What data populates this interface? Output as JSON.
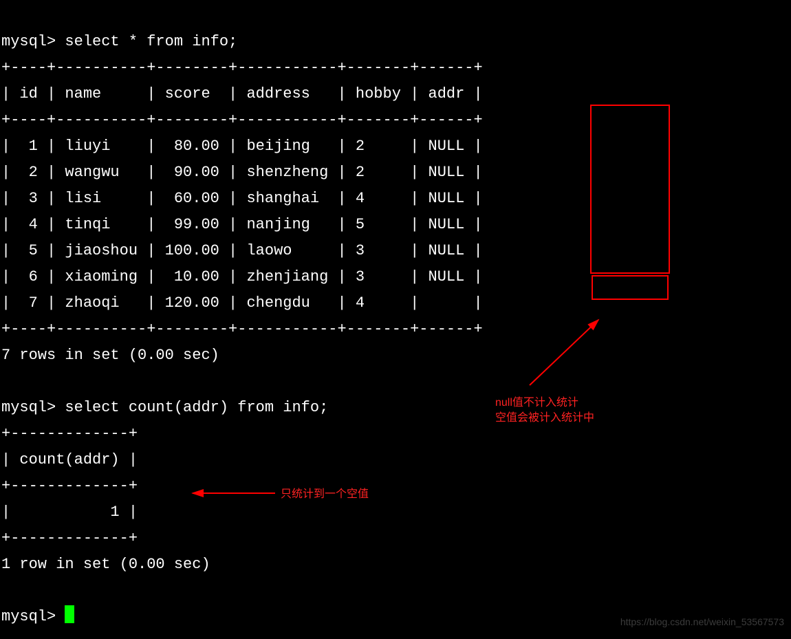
{
  "chart_data": {
    "type": "table",
    "query": "select * from info;",
    "columns": [
      "id",
      "name",
      "score",
      "address",
      "hobby",
      "addr"
    ],
    "rows": [
      {
        "id": 1,
        "name": "liuyi",
        "score": "80.00",
        "address": "beijing",
        "hobby": 2,
        "addr": "NULL"
      },
      {
        "id": 2,
        "name": "wangwu",
        "score": "90.00",
        "address": "shenzheng",
        "hobby": 2,
        "addr": "NULL"
      },
      {
        "id": 3,
        "name": "lisi",
        "score": "60.00",
        "address": "shanghai",
        "hobby": 4,
        "addr": "NULL"
      },
      {
        "id": 4,
        "name": "tinqi",
        "score": "99.00",
        "address": "nanjing",
        "hobby": 5,
        "addr": "NULL"
      },
      {
        "id": 5,
        "name": "jiaoshou",
        "score": "100.00",
        "address": "laowo",
        "hobby": 3,
        "addr": "NULL"
      },
      {
        "id": 6,
        "name": "xiaoming",
        "score": "10.00",
        "address": "zhenjiang",
        "hobby": 3,
        "addr": "NULL"
      },
      {
        "id": 7,
        "name": "zhaoqi",
        "score": "120.00",
        "address": "chengdu",
        "hobby": 4,
        "addr": ""
      }
    ],
    "footer": "7 rows in set (0.00 sec)",
    "count_query": "select count(addr) from info;",
    "count_header": "count(addr)",
    "count_value": "1",
    "count_footer": "1 row in set (0.00 sec)"
  },
  "prompt": "mysql>",
  "term": {
    "line0": "mysql> select * from info;",
    "sep_full": "+----+----------+--------+-----------+-------+------+",
    "header": "| id | name     | score  | address   | hobby | addr |",
    "r1": "|  1 | liuyi    |  80.00 | beijing   | 2     | NULL |",
    "r2": "|  2 | wangwu   |  90.00 | shenzheng | 2     | NULL |",
    "r3": "|  3 | lisi     |  60.00 | shanghai  | 4     | NULL |",
    "r4": "|  4 | tinqi    |  99.00 | nanjing   | 5     | NULL |",
    "r5": "|  5 | jiaoshou | 100.00 | laowo     | 3     | NULL |",
    "r6": "|  6 | xiaoming |  10.00 | zhenjiang | 3     | NULL |",
    "r7": "|  7 | zhaoqi   | 120.00 | chengdu   | 4     |      |",
    "rows_msg": "7 rows in set (0.00 sec)",
    "line_q2": "mysql> select count(addr) from info;",
    "sep_small": "+-------------+",
    "head2": "| count(addr) |",
    "val2": "|           1 |",
    "rows_msg2": "1 row in set (0.00 sec)",
    "final_prompt": "mysql> "
  },
  "annotations": {
    "top1": "null值不计入统计",
    "top2": "空值会被计入统计中",
    "bottom": "只统计到一个空值"
  },
  "watermark": "https://blog.csdn.net/weixin_53567573"
}
